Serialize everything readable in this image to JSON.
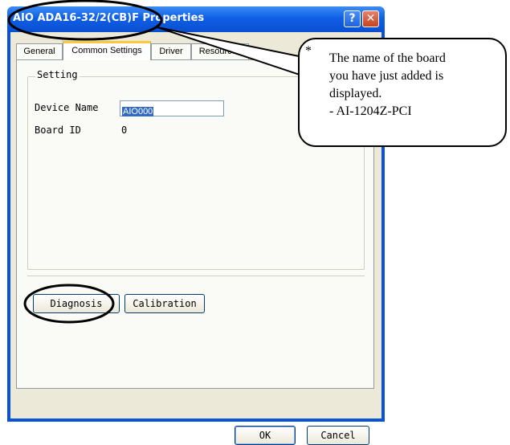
{
  "window": {
    "title": "AIO ADA16-32/2(CB)F Properties",
    "help_glyph": "?",
    "close_glyph": "✕"
  },
  "tabs": [
    {
      "label": "General"
    },
    {
      "label": "Common Settings"
    },
    {
      "label": "Driver"
    },
    {
      "label": "Resources"
    }
  ],
  "active_tab": "Common Settings",
  "setting": {
    "group_label": "Setting",
    "device_name_label": "Device Name",
    "device_name_value": "AIO000",
    "board_id_label": "Board ID",
    "board_id_value": "0"
  },
  "buttons": {
    "diagnosis": "Diagnosis",
    "calibration": "Calibration",
    "ok": "OK",
    "cancel": "Cancel"
  },
  "annotation": {
    "asterisk": "*",
    "lines": [
      "The name of the board",
      "you have just added is",
      "displayed.",
      "- AI-1204Z-PCI"
    ]
  }
}
